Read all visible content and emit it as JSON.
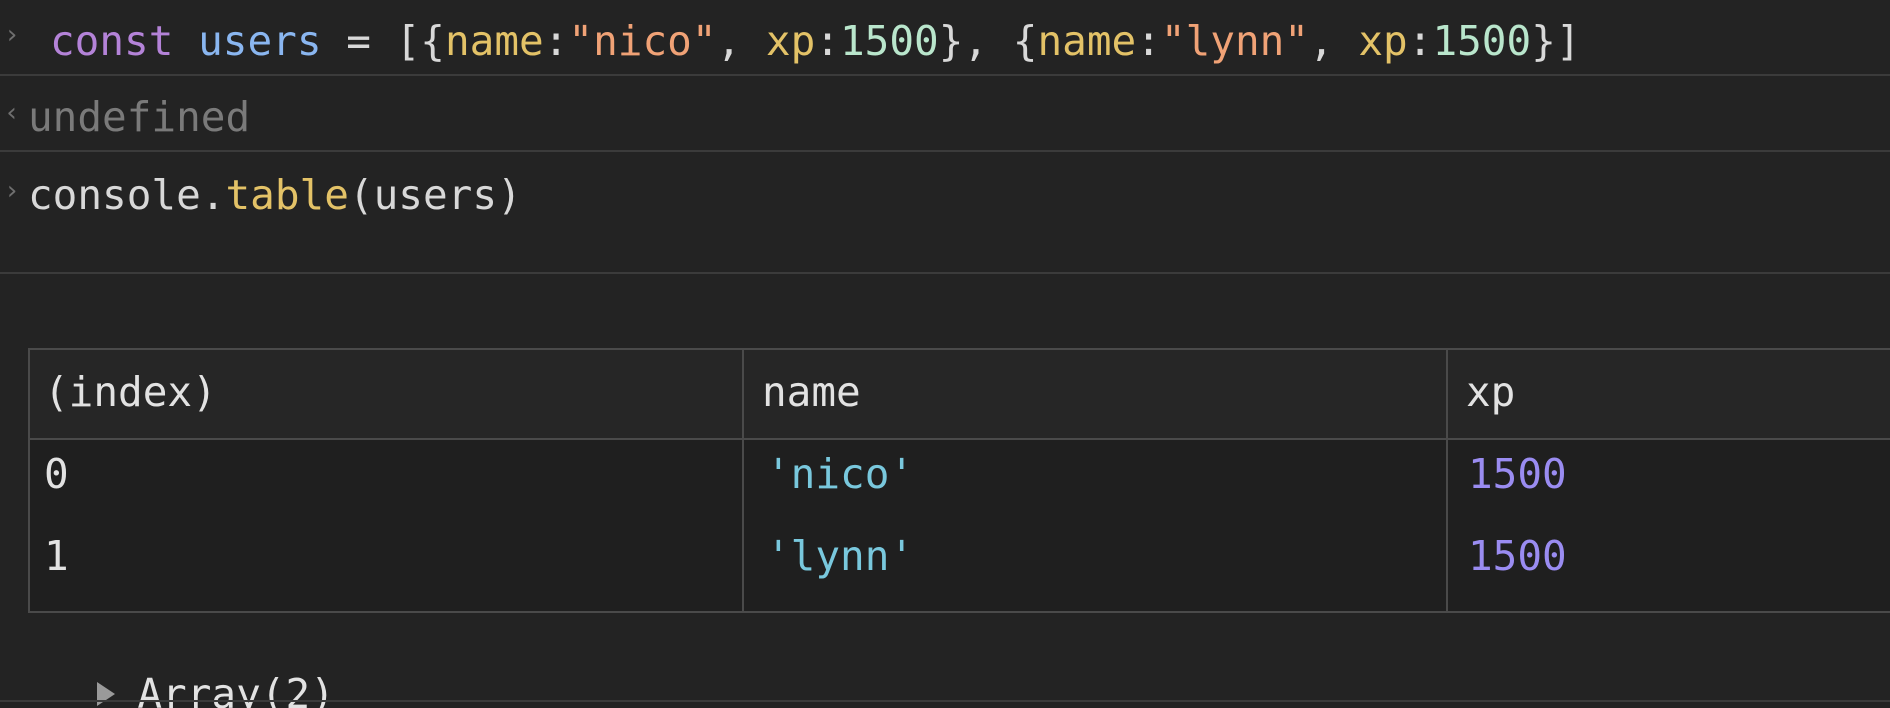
{
  "console": {
    "entry1": {
      "tokens": {
        "kw": "const",
        "var": "users",
        "eq": " = ",
        "open": "[{",
        "k1": "name",
        "c1": ":",
        "s1": "\"nico\"",
        "sep1": ", ",
        "k2": "xp",
        "c2": ":",
        "n1": "1500",
        "mid": "}, {",
        "k3": "name",
        "c3": ":",
        "s2": "\"lynn\"",
        "sep2": ", ",
        "k4": "xp",
        "c4": ":",
        "n2": "1500",
        "close": "}]"
      }
    },
    "result1": "undefined",
    "entry2": {
      "obj": "console.",
      "method": "table",
      "args": "(users)"
    },
    "table": {
      "headers": [
        "(index)",
        "name",
        "xp"
      ],
      "rows": [
        {
          "index": "0",
          "name": "'nico'",
          "xp": "1500"
        },
        {
          "index": "1",
          "name": "'lynn'",
          "xp": "1500"
        }
      ]
    },
    "array_summary": "Array(2)"
  },
  "colors": {
    "background": "#232323",
    "keyword": "#b483d8",
    "string_cell": "#79c8dd",
    "number_cell": "#9a8cf1"
  }
}
